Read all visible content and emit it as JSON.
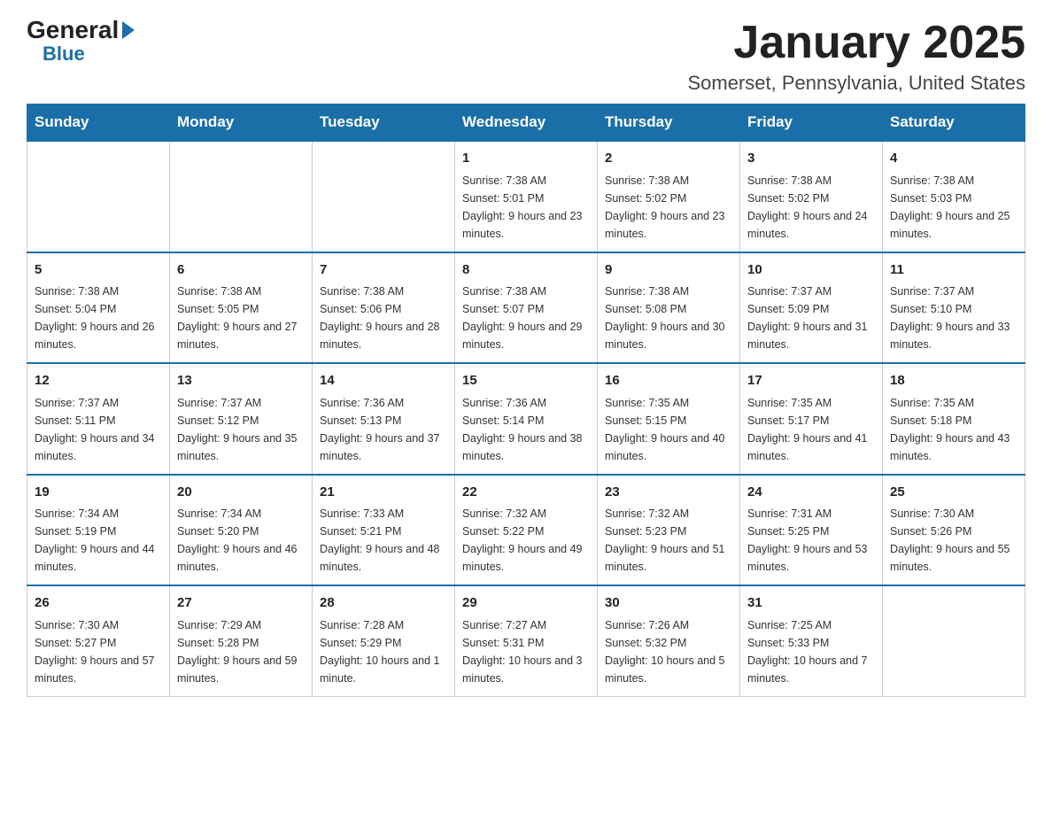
{
  "header": {
    "logo": {
      "general": "General",
      "blue": "Blue"
    },
    "title": "January 2025",
    "subtitle": "Somerset, Pennsylvania, United States"
  },
  "calendar": {
    "days": [
      "Sunday",
      "Monday",
      "Tuesday",
      "Wednesday",
      "Thursday",
      "Friday",
      "Saturday"
    ],
    "weeks": [
      [
        {
          "day": "",
          "info": ""
        },
        {
          "day": "",
          "info": ""
        },
        {
          "day": "",
          "info": ""
        },
        {
          "day": "1",
          "info": "Sunrise: 7:38 AM\nSunset: 5:01 PM\nDaylight: 9 hours and 23 minutes."
        },
        {
          "day": "2",
          "info": "Sunrise: 7:38 AM\nSunset: 5:02 PM\nDaylight: 9 hours and 23 minutes."
        },
        {
          "day": "3",
          "info": "Sunrise: 7:38 AM\nSunset: 5:02 PM\nDaylight: 9 hours and 24 minutes."
        },
        {
          "day": "4",
          "info": "Sunrise: 7:38 AM\nSunset: 5:03 PM\nDaylight: 9 hours and 25 minutes."
        }
      ],
      [
        {
          "day": "5",
          "info": "Sunrise: 7:38 AM\nSunset: 5:04 PM\nDaylight: 9 hours and 26 minutes."
        },
        {
          "day": "6",
          "info": "Sunrise: 7:38 AM\nSunset: 5:05 PM\nDaylight: 9 hours and 27 minutes."
        },
        {
          "day": "7",
          "info": "Sunrise: 7:38 AM\nSunset: 5:06 PM\nDaylight: 9 hours and 28 minutes."
        },
        {
          "day": "8",
          "info": "Sunrise: 7:38 AM\nSunset: 5:07 PM\nDaylight: 9 hours and 29 minutes."
        },
        {
          "day": "9",
          "info": "Sunrise: 7:38 AM\nSunset: 5:08 PM\nDaylight: 9 hours and 30 minutes."
        },
        {
          "day": "10",
          "info": "Sunrise: 7:37 AM\nSunset: 5:09 PM\nDaylight: 9 hours and 31 minutes."
        },
        {
          "day": "11",
          "info": "Sunrise: 7:37 AM\nSunset: 5:10 PM\nDaylight: 9 hours and 33 minutes."
        }
      ],
      [
        {
          "day": "12",
          "info": "Sunrise: 7:37 AM\nSunset: 5:11 PM\nDaylight: 9 hours and 34 minutes."
        },
        {
          "day": "13",
          "info": "Sunrise: 7:37 AM\nSunset: 5:12 PM\nDaylight: 9 hours and 35 minutes."
        },
        {
          "day": "14",
          "info": "Sunrise: 7:36 AM\nSunset: 5:13 PM\nDaylight: 9 hours and 37 minutes."
        },
        {
          "day": "15",
          "info": "Sunrise: 7:36 AM\nSunset: 5:14 PM\nDaylight: 9 hours and 38 minutes."
        },
        {
          "day": "16",
          "info": "Sunrise: 7:35 AM\nSunset: 5:15 PM\nDaylight: 9 hours and 40 minutes."
        },
        {
          "day": "17",
          "info": "Sunrise: 7:35 AM\nSunset: 5:17 PM\nDaylight: 9 hours and 41 minutes."
        },
        {
          "day": "18",
          "info": "Sunrise: 7:35 AM\nSunset: 5:18 PM\nDaylight: 9 hours and 43 minutes."
        }
      ],
      [
        {
          "day": "19",
          "info": "Sunrise: 7:34 AM\nSunset: 5:19 PM\nDaylight: 9 hours and 44 minutes."
        },
        {
          "day": "20",
          "info": "Sunrise: 7:34 AM\nSunset: 5:20 PM\nDaylight: 9 hours and 46 minutes."
        },
        {
          "day": "21",
          "info": "Sunrise: 7:33 AM\nSunset: 5:21 PM\nDaylight: 9 hours and 48 minutes."
        },
        {
          "day": "22",
          "info": "Sunrise: 7:32 AM\nSunset: 5:22 PM\nDaylight: 9 hours and 49 minutes."
        },
        {
          "day": "23",
          "info": "Sunrise: 7:32 AM\nSunset: 5:23 PM\nDaylight: 9 hours and 51 minutes."
        },
        {
          "day": "24",
          "info": "Sunrise: 7:31 AM\nSunset: 5:25 PM\nDaylight: 9 hours and 53 minutes."
        },
        {
          "day": "25",
          "info": "Sunrise: 7:30 AM\nSunset: 5:26 PM\nDaylight: 9 hours and 55 minutes."
        }
      ],
      [
        {
          "day": "26",
          "info": "Sunrise: 7:30 AM\nSunset: 5:27 PM\nDaylight: 9 hours and 57 minutes."
        },
        {
          "day": "27",
          "info": "Sunrise: 7:29 AM\nSunset: 5:28 PM\nDaylight: 9 hours and 59 minutes."
        },
        {
          "day": "28",
          "info": "Sunrise: 7:28 AM\nSunset: 5:29 PM\nDaylight: 10 hours and 1 minute."
        },
        {
          "day": "29",
          "info": "Sunrise: 7:27 AM\nSunset: 5:31 PM\nDaylight: 10 hours and 3 minutes."
        },
        {
          "day": "30",
          "info": "Sunrise: 7:26 AM\nSunset: 5:32 PM\nDaylight: 10 hours and 5 minutes."
        },
        {
          "day": "31",
          "info": "Sunrise: 7:25 AM\nSunset: 5:33 PM\nDaylight: 10 hours and 7 minutes."
        },
        {
          "day": "",
          "info": ""
        }
      ]
    ]
  }
}
